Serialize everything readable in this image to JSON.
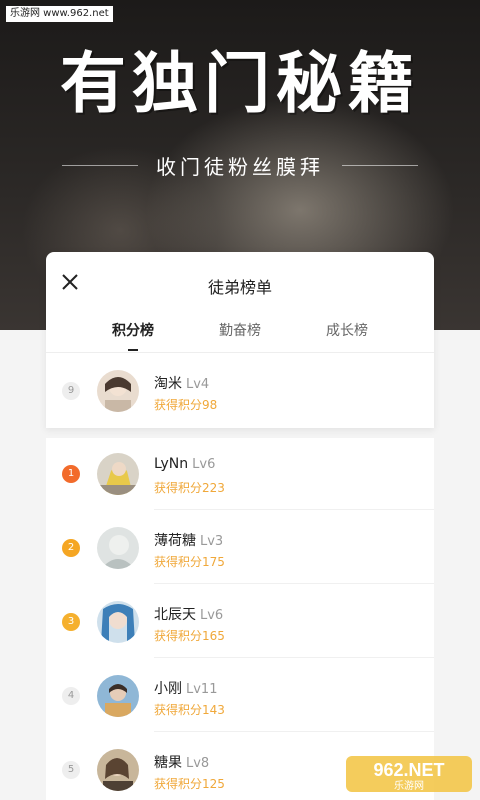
{
  "watermark_top": "乐游网 www.962.net",
  "hero": {
    "title": "有独门秘籍",
    "subtitle": "收门徒粉丝膜拜"
  },
  "panel": {
    "title": "徒弟榜单",
    "tabs": [
      {
        "label": "积分榜",
        "active": true
      },
      {
        "label": "勤奋榜",
        "active": false
      },
      {
        "label": "成长榜",
        "active": false
      }
    ],
    "self_row": {
      "rank": "9",
      "name": "淘米",
      "level": "Lv4",
      "score": "获得积分98"
    }
  },
  "list": [
    {
      "rank": "1",
      "name": "LyNn",
      "level": "Lv6",
      "score": "获得积分223",
      "rank_color": "#f26b2b"
    },
    {
      "rank": "2",
      "name": "薄荷糖",
      "level": "Lv3",
      "score": "获得积分175",
      "rank_color": "#f5a623"
    },
    {
      "rank": "3",
      "name": "北辰天",
      "level": "Lv6",
      "score": "获得积分165",
      "rank_color": "#f5b02e"
    },
    {
      "rank": "4",
      "name": "小刚",
      "level": "Lv11",
      "score": "获得积分143",
      "rank_color": ""
    },
    {
      "rank": "5",
      "name": "糖果",
      "level": "Lv8",
      "score": "获得积分125",
      "rank_color": ""
    }
  ],
  "watermark_bottom": {
    "logo_text": "962.NET",
    "sub_text": "乐游网"
  }
}
